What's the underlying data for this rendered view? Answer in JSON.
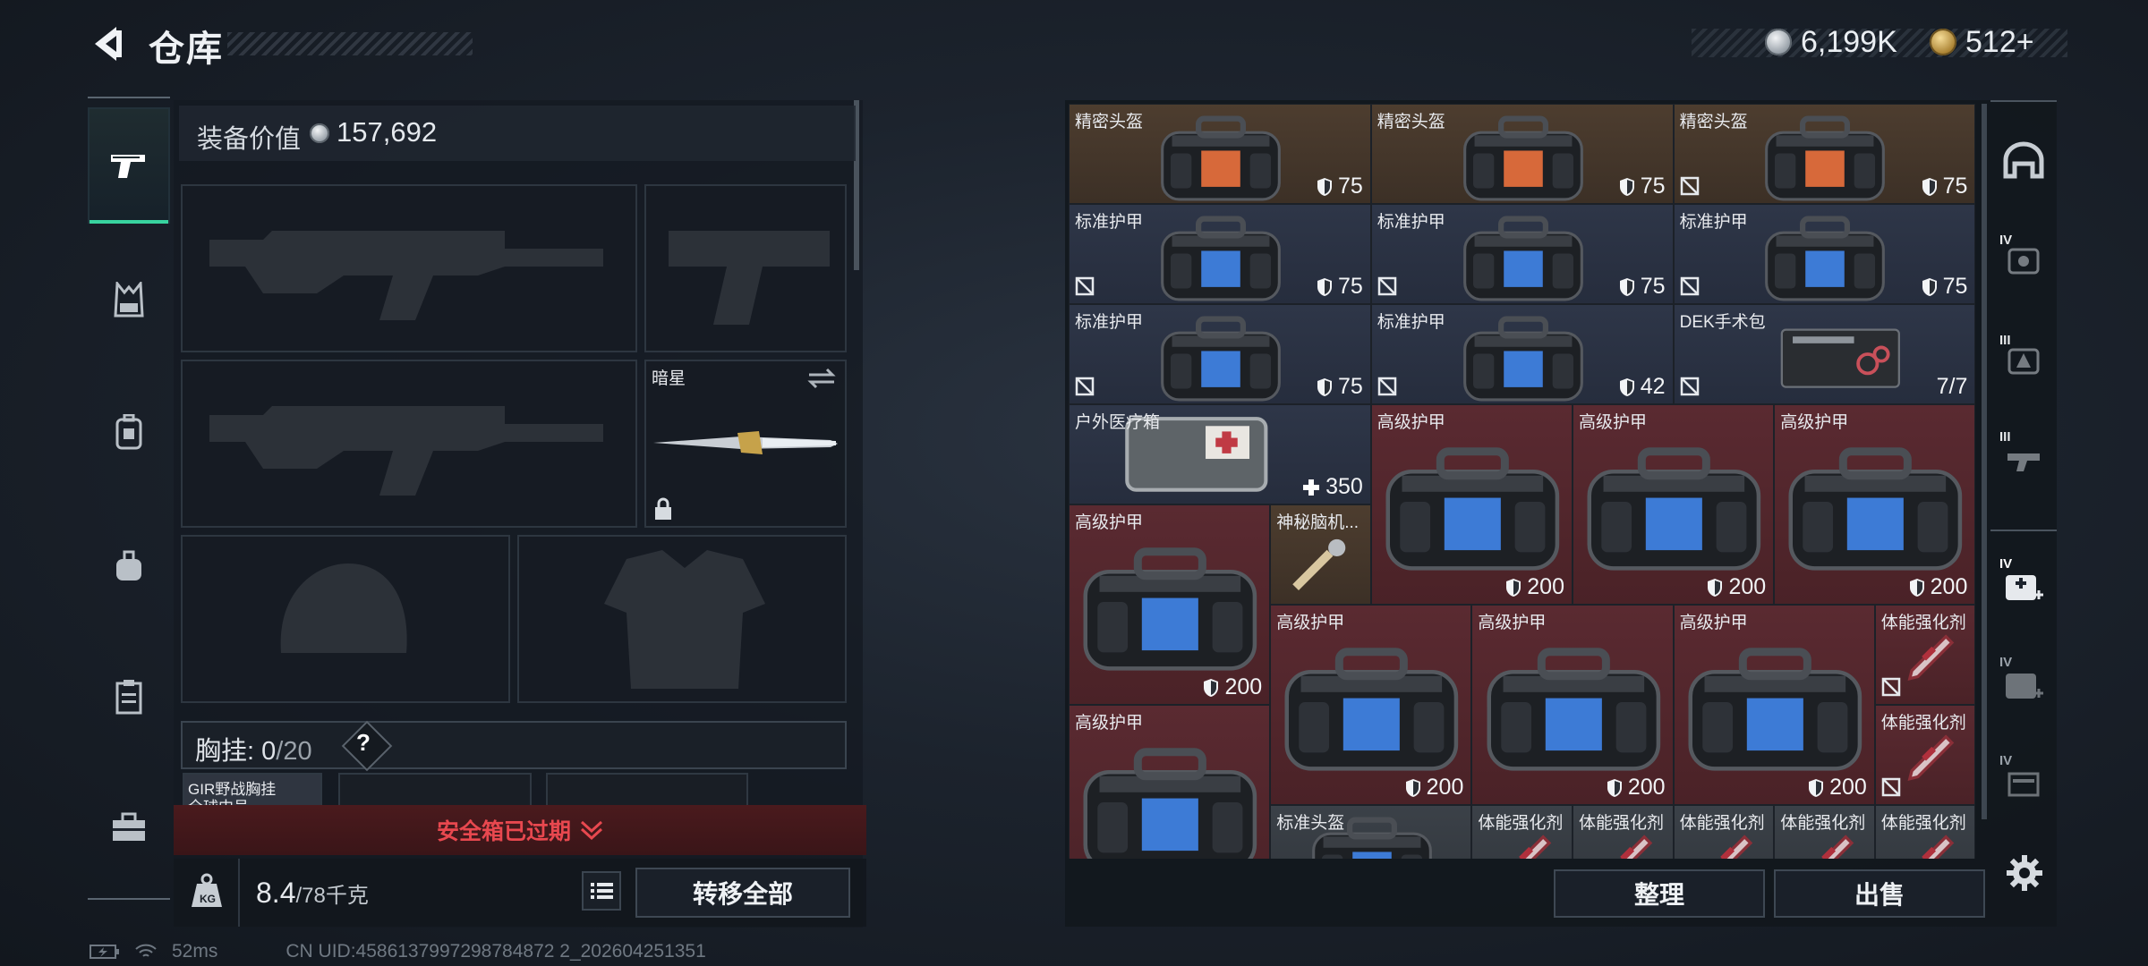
{
  "header": {
    "title": "仓库",
    "silver_amount": "6,199K",
    "gold_amount": "512+"
  },
  "loadout": {
    "value_label": "装备价值",
    "value_amount": "157,692",
    "melee_name": "暗星",
    "chest_rig_label": "胸挂: ",
    "chest_rig_current": "0",
    "chest_rig_max": "/20",
    "help": "?",
    "rig_item_name": "GIR野战胸挂",
    "rig_item_sub": "全球中号",
    "safe_box_status": "安全箱已过期",
    "weight_current": "8.4",
    "weight_max": "/78千克",
    "transfer_all": "转移全部"
  },
  "status_bar": {
    "ping": "52ms",
    "uid": "CN UID:4586137997298784872 2_202604251351"
  },
  "storage": {
    "items": [
      {
        "name": "精密头盔",
        "value": "75",
        "color": "brown",
        "nodrop": false
      },
      {
        "name": "精密头盔",
        "value": "75",
        "color": "brown",
        "nodrop": false
      },
      {
        "name": "精密头盔",
        "value": "75",
        "color": "brown",
        "nodrop": true
      },
      {
        "name": "标准护甲",
        "value": "75",
        "color": "blue",
        "nodrop": true
      },
      {
        "name": "标准护甲",
        "value": "75",
        "color": "blue",
        "nodrop": true
      },
      {
        "name": "标准护甲",
        "value": "75",
        "color": "blue",
        "nodrop": true
      },
      {
        "name": "标准护甲",
        "value": "75",
        "color": "blue",
        "nodrop": true
      },
      {
        "name": "标准护甲",
        "value": "42",
        "color": "blue",
        "nodrop": true
      },
      {
        "name": "DEK手术包",
        "value": "7/7",
        "color": "blue",
        "nodrop": true
      },
      {
        "name": "户外医疗箱",
        "value": "350",
        "color": "blue",
        "nodrop": false
      },
      {
        "name": "高级护甲",
        "value": "200",
        "color": "red",
        "nodrop": false
      },
      {
        "name": "高级护甲",
        "value": "200",
        "color": "red",
        "nodrop": false
      },
      {
        "name": "高级护甲",
        "value": "200",
        "color": "red",
        "nodrop": false
      },
      {
        "name": "高级护甲",
        "value": "200",
        "color": "red",
        "nodrop": false
      },
      {
        "name": "神秘脑机...",
        "value": "",
        "color": "brown",
        "nodrop": false
      },
      {
        "name": "高级护甲",
        "value": "200",
        "color": "red",
        "nodrop": false
      },
      {
        "name": "高级护甲",
        "value": "200",
        "color": "red",
        "nodrop": false
      },
      {
        "name": "高级护甲",
        "value": "200",
        "color": "red",
        "nodrop": false
      },
      {
        "name": "体能强化剂",
        "value": "",
        "color": "red",
        "nodrop": true
      },
      {
        "name": "高级护甲",
        "value": "",
        "color": "red",
        "nodrop": false
      },
      {
        "name": "体能强化剂",
        "value": "",
        "color": "red",
        "nodrop": true
      },
      {
        "name": "标准头盔",
        "value": "",
        "color": "gray",
        "nodrop": false
      },
      {
        "name": "体能强化剂",
        "value": "",
        "color": "gray",
        "nodrop": false
      },
      {
        "name": "体能强化剂",
        "value": "",
        "color": "gray",
        "nodrop": false
      },
      {
        "name": "体能强化剂",
        "value": "",
        "color": "gray",
        "nodrop": false
      },
      {
        "name": "体能强化剂",
        "value": "",
        "color": "gray",
        "nodrop": false
      },
      {
        "name": "体能强化剂",
        "value": "",
        "color": "gray",
        "nodrop": false
      }
    ],
    "sort_label": "整理",
    "sell_label": "出售"
  },
  "right_nav": {
    "tier_labels": [
      "IV",
      "III",
      "III",
      "IV",
      "IV",
      "IV"
    ]
  },
  "icons": {
    "back": "back-arrow-icon",
    "nav": [
      "pistol-icon",
      "vest-icon",
      "backpack-icon",
      "bag-icon",
      "clipboard-icon",
      "toolbox-icon"
    ],
    "right_nav": [
      "helmet-icon",
      "armor-icon",
      "armor-icon",
      "gun-icon",
      "medkit-icon",
      "medkit-icon",
      "ammo-icon"
    ],
    "settings": "gear-icon"
  },
  "colors": {
    "accent": "#38d39f",
    "warning": "#e8484f",
    "rare_red": "#5a2a31",
    "uncommon_blue": "#2e3648",
    "brown": "#4d3d2f"
  }
}
